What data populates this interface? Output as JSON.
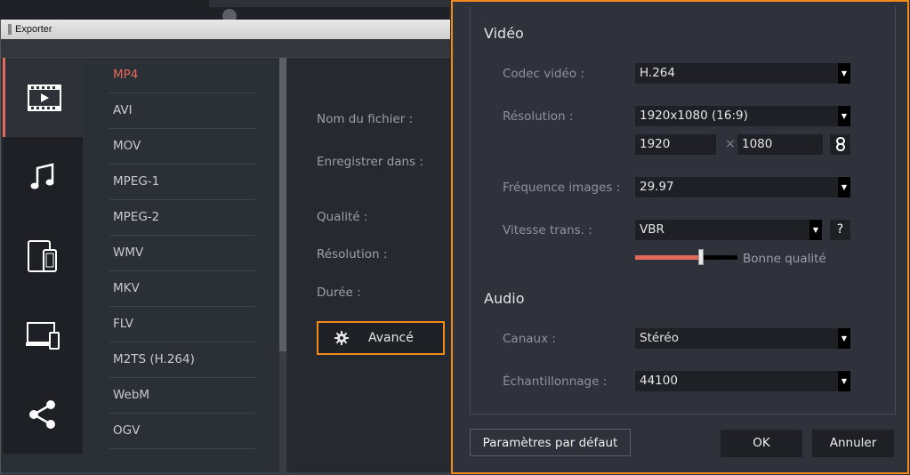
{
  "export_window": {
    "title": "Exporter",
    "categories": [
      {
        "name": "video-icon",
        "active": true
      },
      {
        "name": "audio-icon",
        "active": false
      },
      {
        "name": "devices-icon",
        "active": false
      },
      {
        "name": "tv-icon",
        "active": false
      },
      {
        "name": "share-icon",
        "active": false
      }
    ],
    "formats": [
      "MP4",
      "AVI",
      "MOV",
      "MPEG-1",
      "MPEG-2",
      "WMV",
      "MKV",
      "FLV",
      "M2TS (H.264)",
      "WebM",
      "OGV"
    ],
    "selected_format": "MP4",
    "fields": {
      "filename_label": "Nom du fichier :",
      "save_in_label": "Enregistrer dans :",
      "quality_label": "Qualité :",
      "resolution_label": "Résolution :",
      "duration_label": "Durée :"
    },
    "advanced_button": "Avancé"
  },
  "advanced_panel": {
    "video_heading": "Vidéo",
    "codec_label": "Codec vidéo :",
    "codec_value": "H.264",
    "resolution_label": "Résolution :",
    "resolution_value": "1920x1080 (16:9)",
    "width_value": "1920",
    "height_value": "1080",
    "times_symbol": "×",
    "framerate_label": "Fréquence images :",
    "framerate_value": "29.97",
    "bitrate_label": "Vitesse trans. :",
    "bitrate_value": "VBR",
    "help_symbol": "?",
    "quality_slider_fraction": 0.64,
    "quality_label": "Bonne qualité",
    "audio_heading": "Audio",
    "channels_label": "Canaux :",
    "channels_value": "Stéréo",
    "samplerate_label": "Échantillonnage :",
    "samplerate_value": "44100",
    "default_button": "Paramètres par défaut",
    "ok_button": "OK",
    "cancel_button": "Annuler"
  },
  "colors": {
    "accent": "#e26a5a",
    "highlight_border": "#f08a1c"
  }
}
